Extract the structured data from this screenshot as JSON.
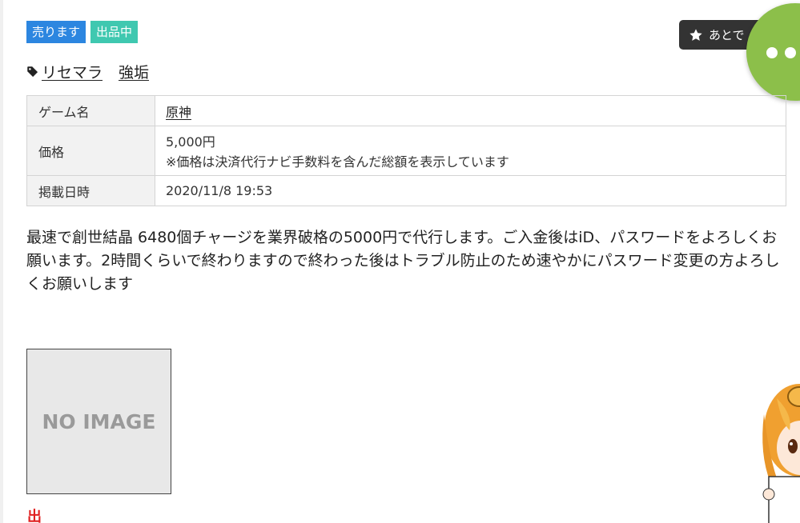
{
  "badges": {
    "sell": "売ります",
    "listing": "出品中"
  },
  "later_button": {
    "label": "あとで",
    "icon": "star-icon"
  },
  "chat_fab": {
    "icon": "chat-dots-icon",
    "color": "#8cbf4a"
  },
  "tags": [
    "リセマラ",
    "強垢"
  ],
  "info": {
    "game": {
      "label": "ゲーム名",
      "value": "原神"
    },
    "price": {
      "label": "価格",
      "value": "5,000円",
      "note": "※価格は決済代行ナビ手数料を含んだ総額を表示しています"
    },
    "date": {
      "label": "掲載日時",
      "value": "2020/11/8 19:53"
    }
  },
  "description": "最速で創世結晶 6480個チャージを業界破格の5000円で代行します。ご入金後はiD、パスワードをよろしくお願います。2時間くらいで終わりますので終わった後はトラブル防止のため速やかにパスワード変更の方よろしくお願いします",
  "image_placeholder": "NO IMAGE",
  "mascot": {
    "label": "出"
  },
  "colors": {
    "sell_badge": "#2c86e0",
    "listing_badge": "#3fc8b0",
    "later_button_bg": "#333333",
    "table_header_bg": "#f2f2f2"
  }
}
